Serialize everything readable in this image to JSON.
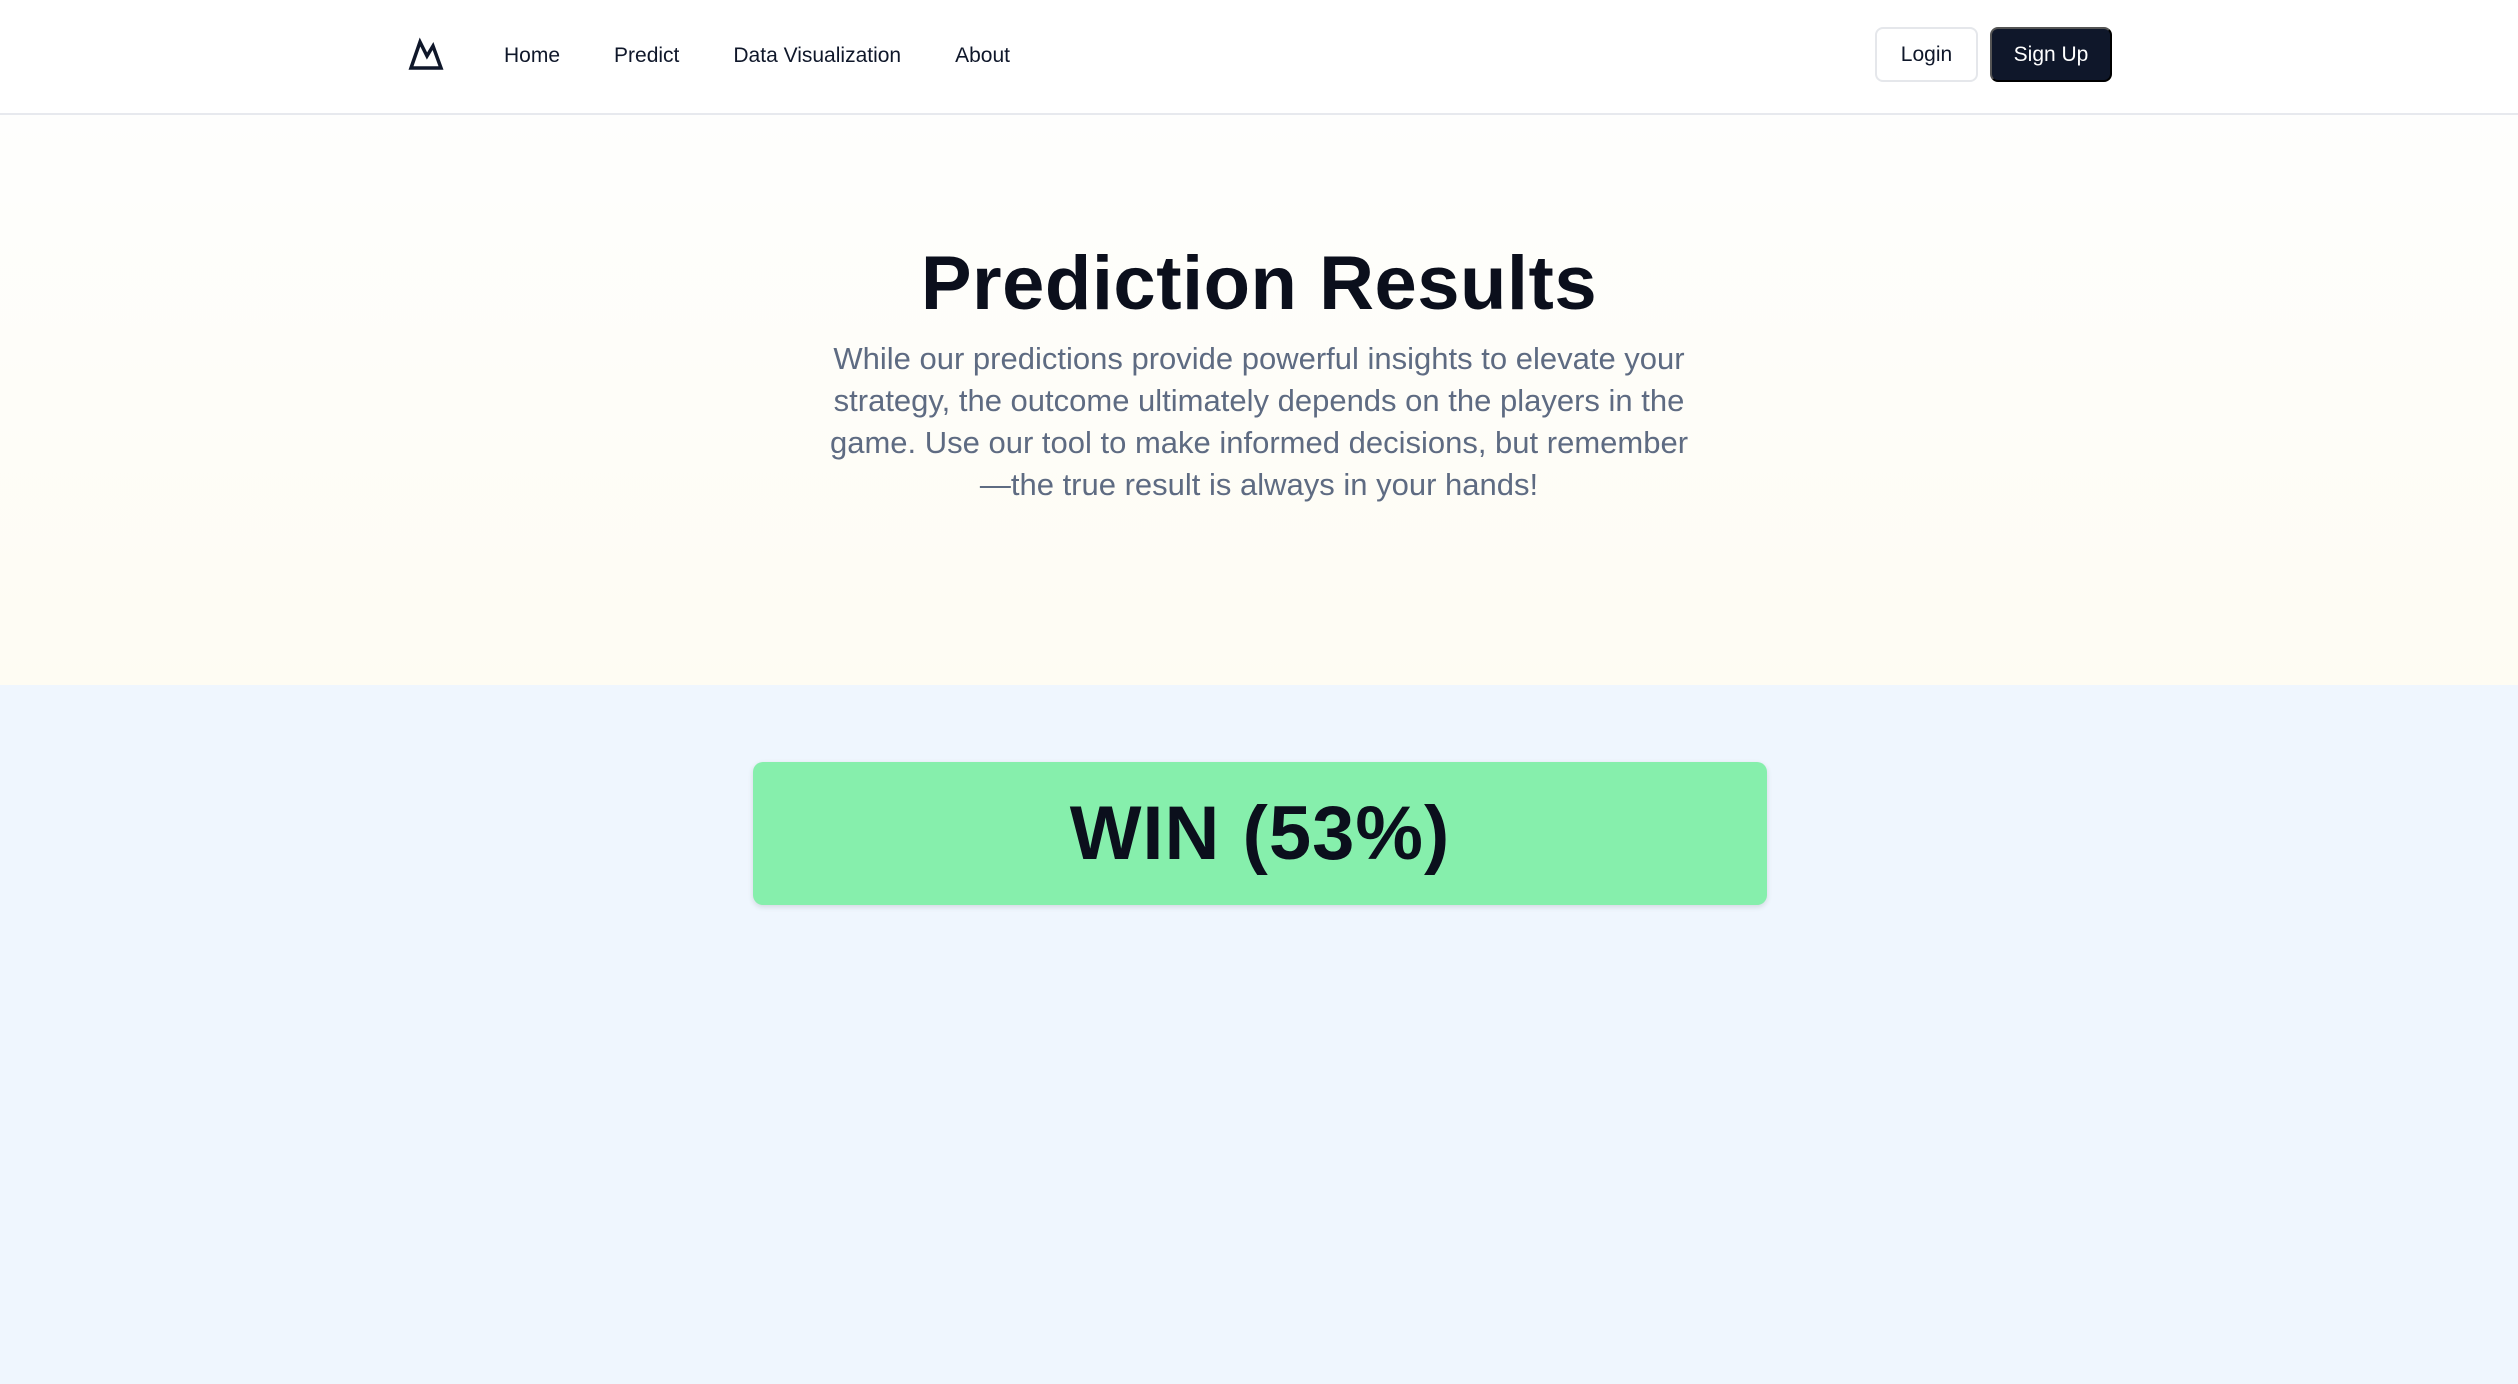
{
  "nav": {
    "logo_icon": "mountain-icon",
    "links": [
      "Home",
      "Predict",
      "Data Visualization",
      "About"
    ],
    "login_label": "Login",
    "signup_label": "Sign Up"
  },
  "hero": {
    "title": "Prediction Results",
    "subtitle": "While our predictions provide powerful insights to elevate your strategy, the outcome ultimately depends on the players in the game. Use our tool to make informed decisions, but remember—the true result is always in your hands!"
  },
  "result": {
    "label": "WIN (53%)",
    "color": "#86efac"
  },
  "colors": {
    "primary_dark": "#0f172a",
    "subtitle_text": "#5e6b82",
    "page_bg": "#eff6fe"
  }
}
